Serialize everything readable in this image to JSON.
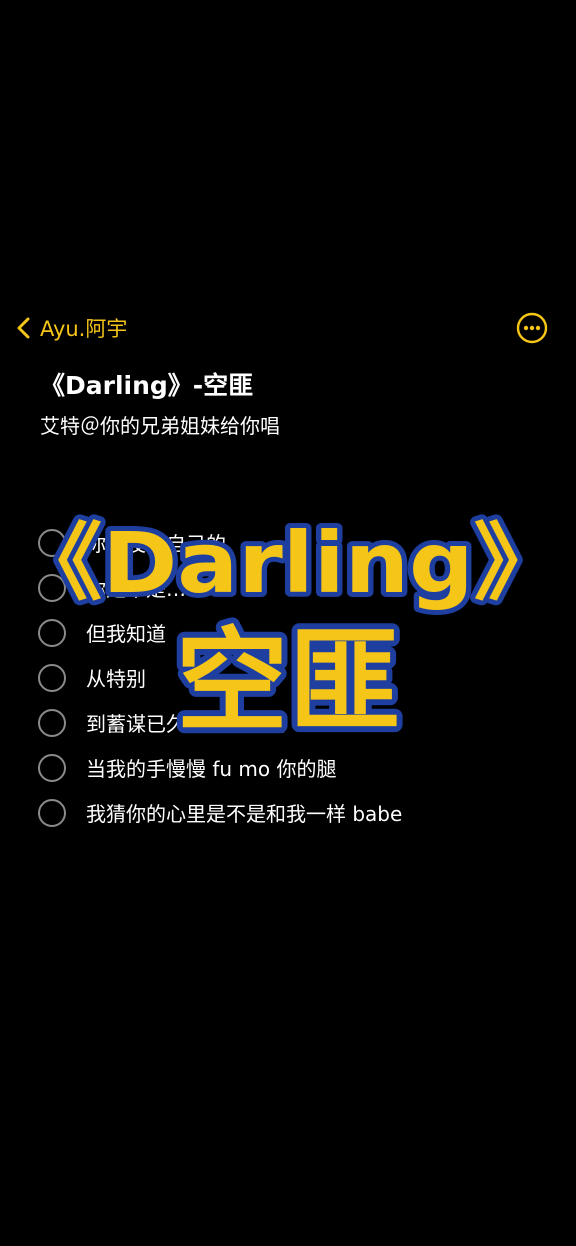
{
  "nav": {
    "back_label": "Ayu.阿宇",
    "more_icon": "ellipsis-circle-icon",
    "accent_color": "#f5c518"
  },
  "note": {
    "title": "《Darling》-空匪",
    "subtitle": "艾特＠你的兄弟姐妹给你唱"
  },
  "checklist": {
    "items": [
      {
        "text": "你有没有自己的"
      },
      {
        "text": "你是不是…"
      },
      {
        "text": "但我知道"
      },
      {
        "text": "从特别"
      },
      {
        "text": "到蓄谋已久的亲你的嘴"
      },
      {
        "text": "当我的手慢慢 fu mo 你的腿"
      },
      {
        "text": "我猜你的心里是不是和我一样 babe"
      }
    ]
  },
  "overlay": {
    "line1": "《Darling》",
    "line2": "空匪",
    "fill_color": "#f5c518",
    "stroke_color": "#1e3fa0"
  }
}
